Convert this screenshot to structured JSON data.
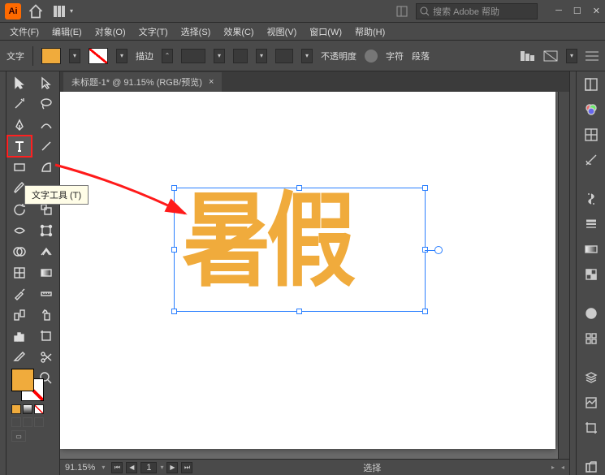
{
  "app": {
    "logo": "Ai"
  },
  "search": {
    "placeholder": "搜索 Adobe 帮助"
  },
  "menu": {
    "file": "文件(F)",
    "edit": "编辑(E)",
    "object": "对象(O)",
    "type": "文字(T)",
    "select": "选择(S)",
    "effect": "效果(C)",
    "view": "视图(V)",
    "window": "窗口(W)",
    "help": "帮助(H)"
  },
  "control": {
    "mode_label": "文字",
    "stroke_label": "描边",
    "opacity_label": "不透明度",
    "char_label": "字符",
    "para_label": "段落"
  },
  "doc": {
    "tab_title": "未标题-1* @ 91.15% (RGB/预览)",
    "text_content": "暑假"
  },
  "tooltip": {
    "type_tool": "文字工具 (T)"
  },
  "status": {
    "zoom": "91.15%",
    "page": "1",
    "mode": "选择"
  },
  "colors": {
    "fill": "#f0ab3c"
  }
}
